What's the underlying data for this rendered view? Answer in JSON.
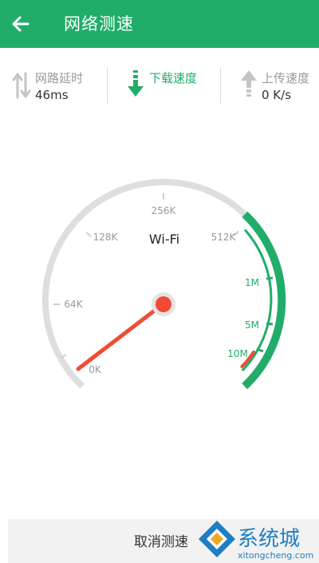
{
  "header": {
    "title": "网络测速",
    "back_icon": "arrow-left-icon",
    "bg_color": "#21ad69"
  },
  "stats": [
    {
      "label": "网路延时",
      "value": "46ms",
      "icon": "up-down-arrows-icon",
      "active": false
    },
    {
      "label": "下载速度",
      "value": "",
      "icon": "download-arrow-icon",
      "active": true
    },
    {
      "label": "上传速度",
      "value": "0 K/s",
      "icon": "upload-arrow-icon",
      "active": false
    }
  ],
  "gauge": {
    "network_label": "Wi-Fi",
    "ticks": [
      "0K",
      "64K",
      "128K",
      "256K",
      "512K",
      "1M",
      "5M",
      "10M"
    ],
    "reached_tick": "512K",
    "accent_color": "#21ad69",
    "needle_color": "#f24b35"
  },
  "footer": {
    "cancel_label": "取消测速"
  },
  "watermark": {
    "text": "系统城",
    "url_text": "xitongcheng.com"
  }
}
